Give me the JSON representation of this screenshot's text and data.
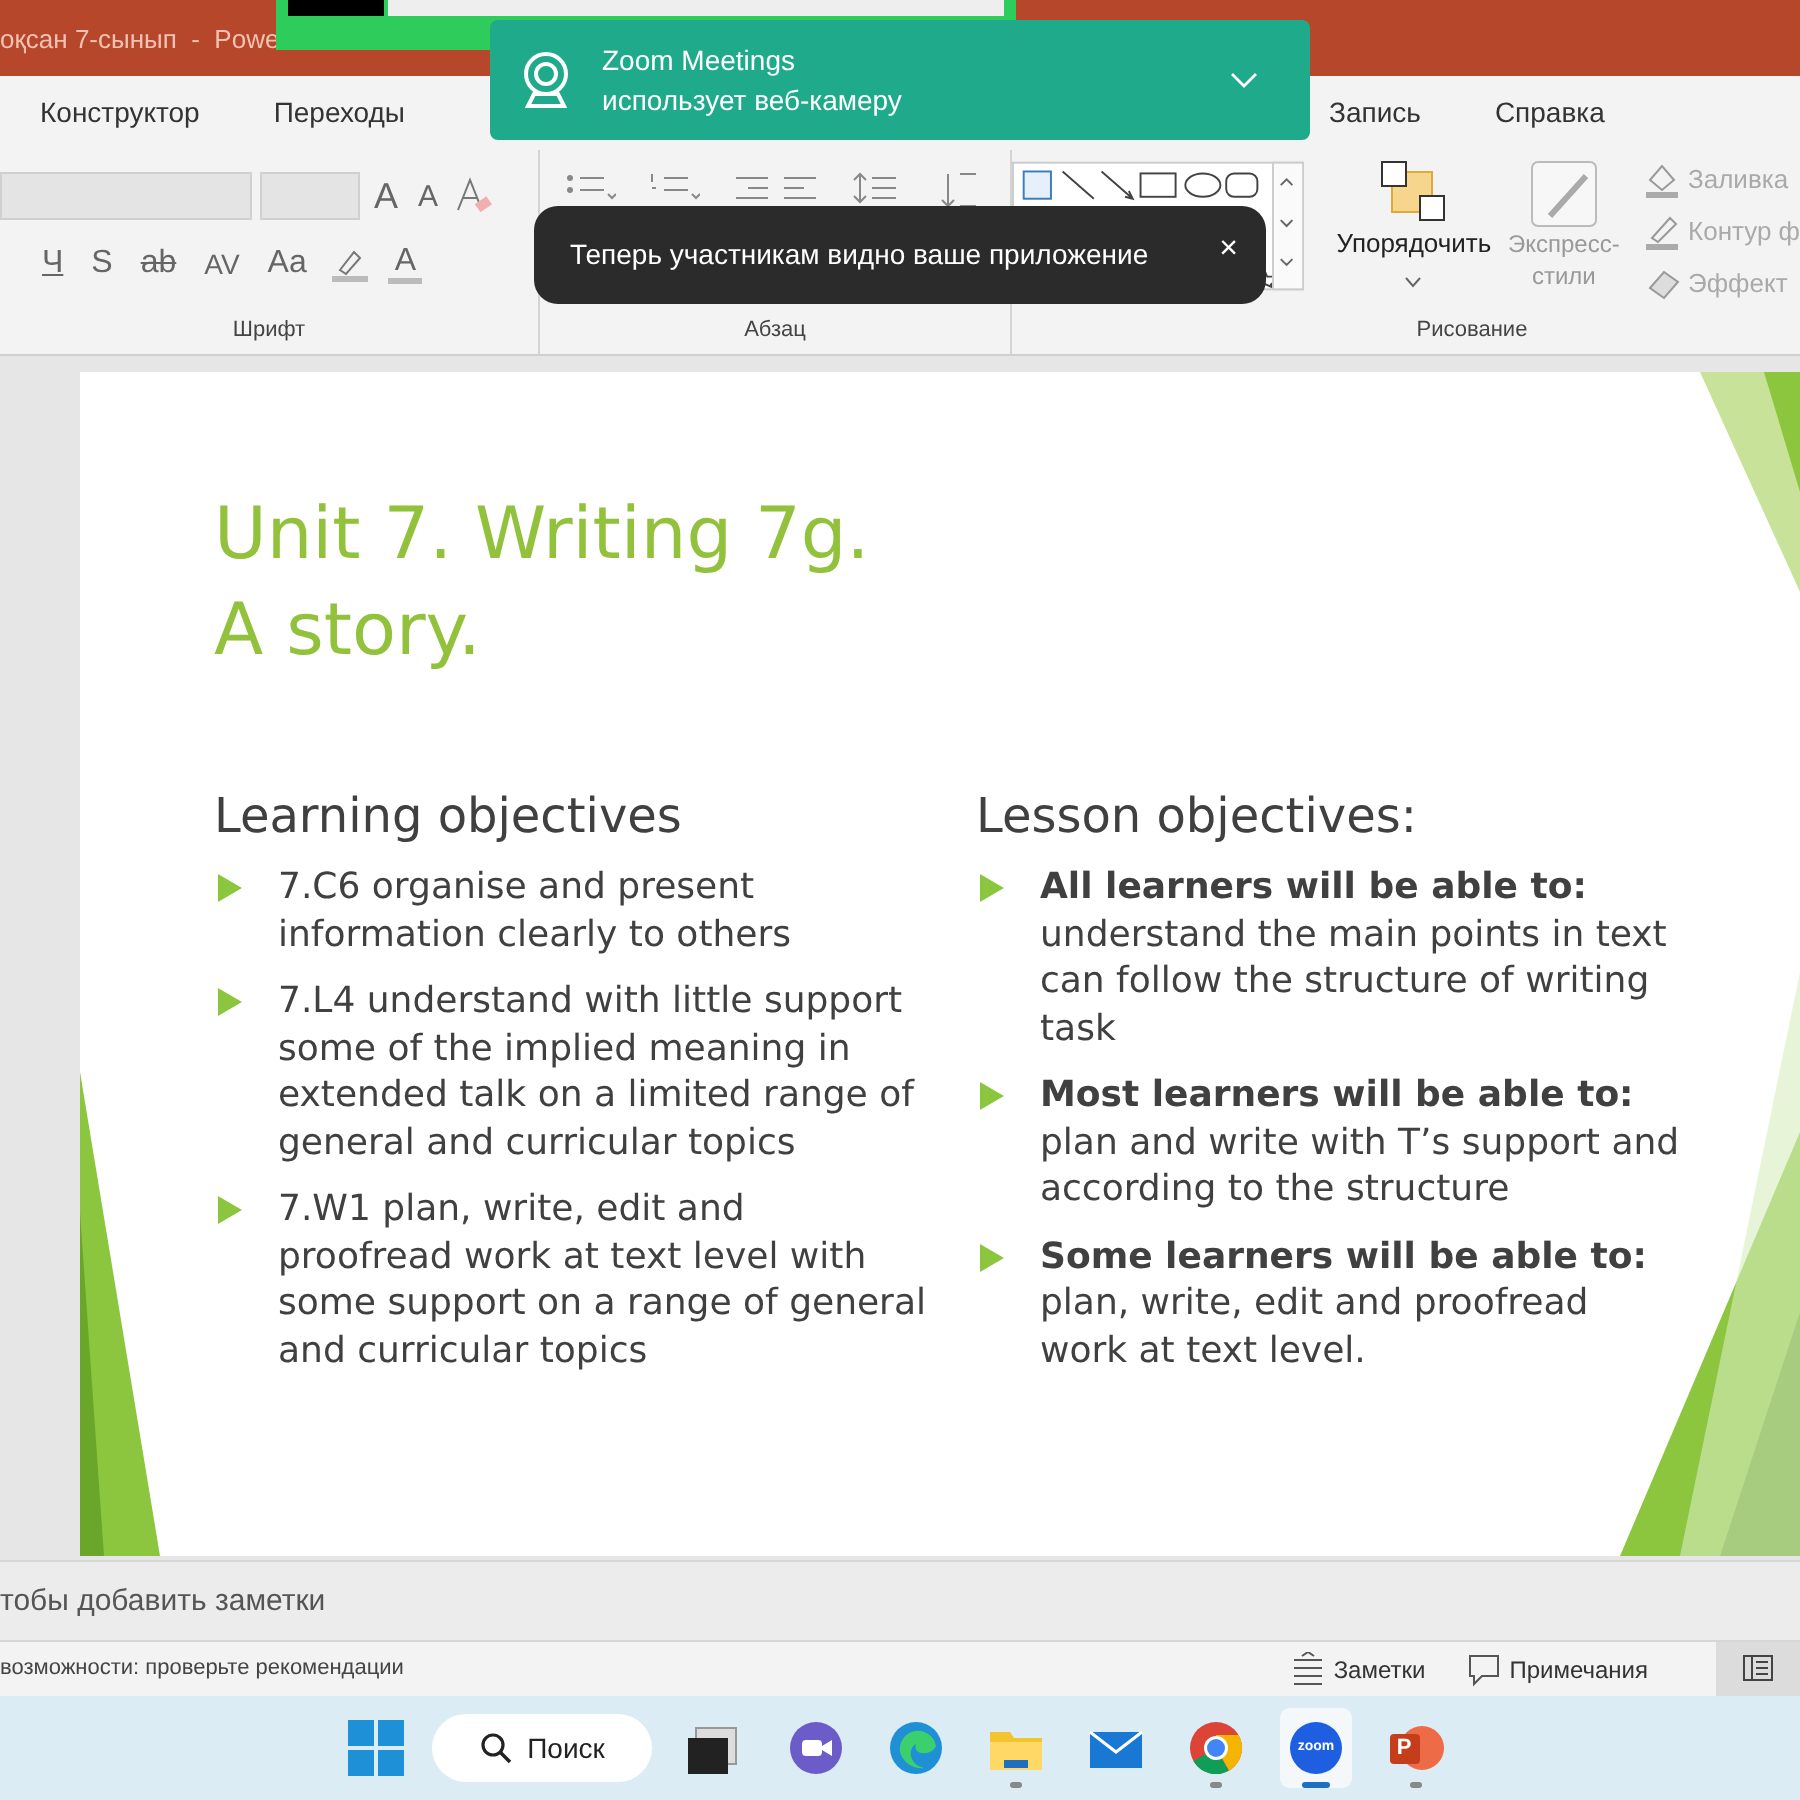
{
  "title_bar": {
    "title": "оқсан 7-сынып  -  Powe"
  },
  "tabs": [
    {
      "label": "Конструктор",
      "selected": false
    },
    {
      "label": "Переходы",
      "selected": false
    },
    {
      "label": "Запись",
      "selected": false
    },
    {
      "label": "Справка",
      "selected": false
    }
  ],
  "ribbon": {
    "font_group": {
      "label": "Шрифт",
      "size_buttons": [
        "A",
        "A"
      ],
      "format_buttons": [
        {
          "text": "Ч",
          "kind": "underline"
        },
        {
          "text": "S",
          "kind": "shadow"
        },
        {
          "text": "ab",
          "kind": "strike"
        },
        {
          "text": "AV",
          "kind": "spacing"
        },
        {
          "text": "Aa",
          "kind": "case"
        }
      ],
      "color_buttons": [
        {
          "kind": "highlight"
        },
        {
          "kind": "font-color",
          "text": "A"
        }
      ]
    },
    "paragraph_group": {
      "label": "Абзац"
    },
    "drawing_group": {
      "label": "Рисование",
      "arrange": "Упорядочить",
      "quick_styles": "Экспресс-стили",
      "side_buttons": [
        {
          "kind": "fill",
          "label": "Заливка"
        },
        {
          "kind": "outline",
          "label": "Контур ф"
        },
        {
          "kind": "effects",
          "label": "Эффект"
        }
      ]
    }
  },
  "slide": {
    "title_lines": [
      "Unit 7. Writing 7g.",
      "A story."
    ],
    "columns": [
      {
        "heading": "Learning objectives",
        "items": [
          "7.C6 organise and present information clearly to others",
          "7.L4 understand with little support some of the implied meaning in extended talk on a limited range of general and curricular topics",
          "7.W1 plan, write, edit and proofread work at text level with some support on a range of general and curricular topics"
        ]
      },
      {
        "heading": "Lesson objectives:",
        "items": [
          "**All learners will be able to:** understand the main points in text can follow the structure of writing task",
          "**Most learners will be able to:** plan and write with T’s support and according to the structure",
          "**Some learners will be able to:** plan, write, edit and proofread work at text level."
        ]
      }
    ]
  },
  "notes": {
    "placeholder": "тобы добавить заметки"
  },
  "status_bar": {
    "text": "возможности: проверьте рекомендации",
    "buttons": [
      {
        "kind": "notes",
        "label": "Заметки"
      },
      {
        "kind": "comments",
        "label": "Примечания"
      }
    ]
  },
  "taskbar": {
    "search": "Поиск",
    "apps": [
      {
        "kind": "taskview",
        "running": false,
        "selected": false
      },
      {
        "kind": "chat",
        "running": false,
        "selected": false
      },
      {
        "kind": "edge",
        "running": false,
        "selected": false
      },
      {
        "kind": "explorer",
        "running": true,
        "selected": false
      },
      {
        "kind": "mail",
        "running": false,
        "selected": false
      },
      {
        "kind": "chrome",
        "running": true,
        "selected": false
      },
      {
        "kind": "zoom",
        "label": "zoom",
        "running": true,
        "selected": true
      },
      {
        "kind": "powerpoint",
        "label": "P",
        "running": true,
        "selected": false
      }
    ]
  },
  "zoom_notification": {
    "app": "Zoom Meetings",
    "message": "использует веб-камеру"
  },
  "toast": {
    "message": "Теперь участникам видно ваше приложение",
    "close": "×"
  }
}
